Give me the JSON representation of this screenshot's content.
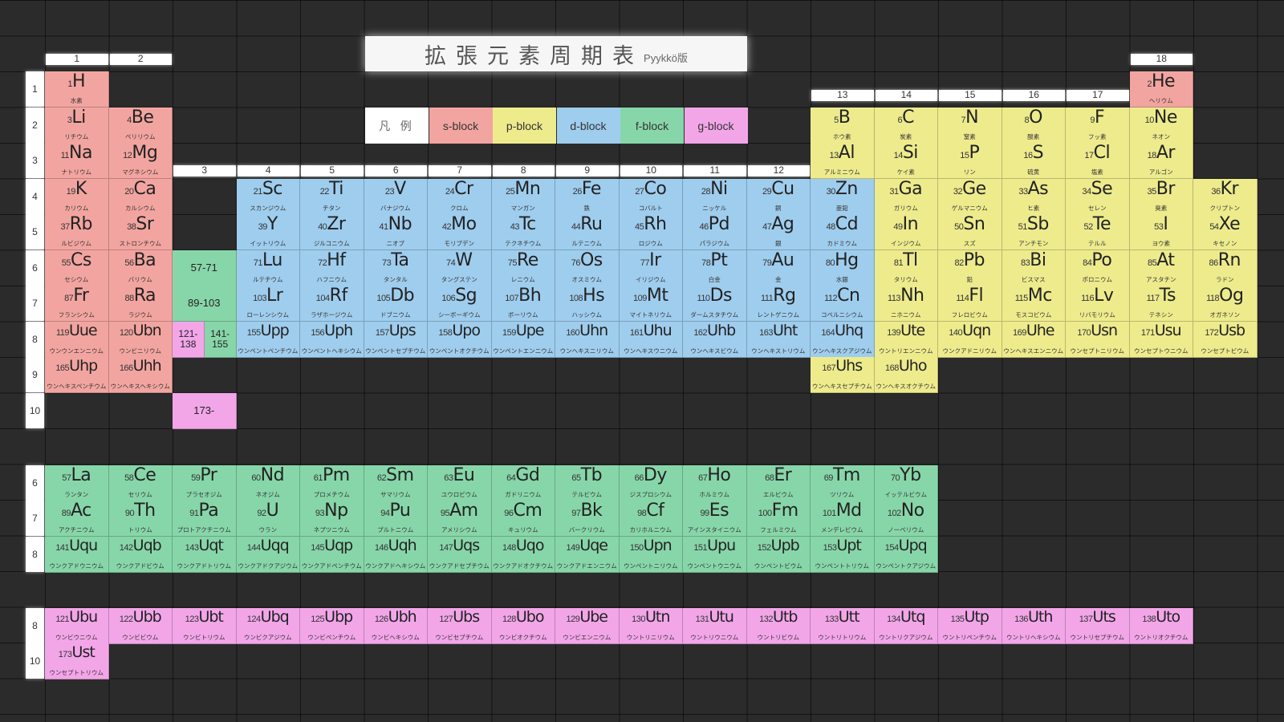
{
  "title": {
    "text": "拡張元素周期表",
    "subtitle": "Pyykkö版"
  },
  "legend": [
    {
      "label": "凡 例",
      "block": "none"
    },
    {
      "label": "s-block",
      "block": "s"
    },
    {
      "label": "p-block",
      "block": "p"
    },
    {
      "label": "d-block",
      "block": "d"
    },
    {
      "label": "f-block",
      "block": "f"
    },
    {
      "label": "g-block",
      "block": "g"
    }
  ],
  "block_colors": {
    "s": "#f2a5a0",
    "p": "#eeeb8d",
    "d": "#9fcdee",
    "f": "#87d6a9",
    "g": "#f2a6e8"
  },
  "group_headers": [
    "1",
    "2",
    "3",
    "4",
    "5",
    "6",
    "7",
    "8",
    "9",
    "10",
    "11",
    "12",
    "13",
    "14",
    "15",
    "16",
    "17",
    "18"
  ],
  "period_headers": [
    "1",
    "2",
    "3",
    "4",
    "5",
    "6",
    "7",
    "8",
    "9",
    "10"
  ],
  "sub_period_headers": [
    "6",
    "7",
    "8",
    "8",
    "10"
  ],
  "main_rows": [
    [
      [
        1,
        "H",
        "水素",
        "s"
      ],
      null,
      null,
      null,
      null,
      null,
      null,
      null,
      null,
      null,
      null,
      null,
      null,
      null,
      null,
      null,
      null,
      [
        2,
        "He",
        "ヘリウム",
        "s"
      ]
    ],
    [
      [
        3,
        "Li",
        "リチウム",
        "s"
      ],
      [
        4,
        "Be",
        "ベリリウム",
        "s"
      ],
      null,
      null,
      null,
      null,
      null,
      null,
      null,
      null,
      null,
      null,
      [
        5,
        "B",
        "ホウ素",
        "p"
      ],
      [
        6,
        "C",
        "炭素",
        "p"
      ],
      [
        7,
        "N",
        "窒素",
        "p"
      ],
      [
        8,
        "O",
        "酸素",
        "p"
      ],
      [
        9,
        "F",
        "フッ素",
        "p"
      ],
      [
        10,
        "Ne",
        "ネオン",
        "p"
      ]
    ],
    [
      [
        11,
        "Na",
        "ナトリウム",
        "s"
      ],
      [
        12,
        "Mg",
        "マグネシウム",
        "s"
      ],
      null,
      null,
      null,
      null,
      null,
      null,
      null,
      null,
      null,
      null,
      [
        13,
        "Al",
        "アルミニウム",
        "p"
      ],
      [
        14,
        "Si",
        "ケイ素",
        "p"
      ],
      [
        15,
        "P",
        "リン",
        "p"
      ],
      [
        16,
        "S",
        "硫黄",
        "p"
      ],
      [
        17,
        "Cl",
        "塩素",
        "p"
      ],
      [
        18,
        "Ar",
        "アルゴン",
        "p"
      ]
    ],
    [
      [
        19,
        "K",
        "カリウム",
        "s"
      ],
      [
        20,
        "Ca",
        "カルシウム",
        "s"
      ],
      null,
      [
        21,
        "Sc",
        "スカンジウム",
        "d"
      ],
      [
        22,
        "Ti",
        "チタン",
        "d"
      ],
      [
        23,
        "V",
        "バナジウム",
        "d"
      ],
      [
        24,
        "Cr",
        "クロム",
        "d"
      ],
      [
        25,
        "Mn",
        "マンガン",
        "d"
      ],
      [
        26,
        "Fe",
        "鉄",
        "d"
      ],
      [
        27,
        "Co",
        "コバルト",
        "d"
      ],
      [
        28,
        "Ni",
        "ニッケル",
        "d"
      ],
      [
        29,
        "Cu",
        "銅",
        "d"
      ],
      [
        30,
        "Zn",
        "亜鉛",
        "d"
      ],
      [
        31,
        "Ga",
        "ガリウム",
        "p"
      ],
      [
        32,
        "Ge",
        "ゲルマニウム",
        "p"
      ],
      [
        33,
        "As",
        "ヒ素",
        "p"
      ],
      [
        34,
        "Se",
        "セレン",
        "p"
      ],
      [
        35,
        "Br",
        "臭素",
        "p"
      ],
      [
        36,
        "Kr",
        "クリプトン",
        "p"
      ]
    ],
    [
      [
        37,
        "Rb",
        "ルビジウム",
        "s"
      ],
      [
        38,
        "Sr",
        "ストロンチウム",
        "s"
      ],
      null,
      [
        39,
        "Y",
        "イットリウム",
        "d"
      ],
      [
        40,
        "Zr",
        "ジルコニウム",
        "d"
      ],
      [
        41,
        "Nb",
        "ニオブ",
        "d"
      ],
      [
        42,
        "Mo",
        "モリブデン",
        "d"
      ],
      [
        43,
        "Tc",
        "テクネチウム",
        "d"
      ],
      [
        44,
        "Ru",
        "ルテニウム",
        "d"
      ],
      [
        45,
        "Rh",
        "ロジウム",
        "d"
      ],
      [
        46,
        "Pd",
        "パラジウム",
        "d"
      ],
      [
        47,
        "Ag",
        "銀",
        "d"
      ],
      [
        48,
        "Cd",
        "カドミウム",
        "d"
      ],
      [
        49,
        "In",
        "インジウム",
        "p"
      ],
      [
        50,
        "Sn",
        "スズ",
        "p"
      ],
      [
        51,
        "Sb",
        "アンチモン",
        "p"
      ],
      [
        52,
        "Te",
        "テルル",
        "p"
      ],
      [
        53,
        "I",
        "ヨウ素",
        "p"
      ],
      [
        54,
        "Xe",
        "キセノン",
        "p"
      ]
    ],
    [
      [
        55,
        "Cs",
        "セシウム",
        "s"
      ],
      [
        56,
        "Ba",
        "バリウム",
        "s"
      ],
      [
        "57-71",
        "f"
      ],
      [
        71,
        "Lu",
        "ルテチウム",
        "d"
      ],
      [
        72,
        "Hf",
        "ハフニウム",
        "d"
      ],
      [
        73,
        "Ta",
        "タンタル",
        "d"
      ],
      [
        74,
        "W",
        "タングステン",
        "d"
      ],
      [
        75,
        "Re",
        "レニウム",
        "d"
      ],
      [
        76,
        "Os",
        "オスミウム",
        "d"
      ],
      [
        77,
        "Ir",
        "イリジウム",
        "d"
      ],
      [
        78,
        "Pt",
        "白金",
        "d"
      ],
      [
        79,
        "Au",
        "金",
        "d"
      ],
      [
        80,
        "Hg",
        "水銀",
        "d"
      ],
      [
        81,
        "Tl",
        "タリウム",
        "p"
      ],
      [
        82,
        "Pb",
        "鉛",
        "p"
      ],
      [
        83,
        "Bi",
        "ビスマス",
        "p"
      ],
      [
        84,
        "Po",
        "ポロニウム",
        "p"
      ],
      [
        85,
        "At",
        "アスタチン",
        "p"
      ],
      [
        86,
        "Rn",
        "ラドン",
        "p"
      ]
    ],
    [
      [
        87,
        "Fr",
        "フランシウム",
        "s"
      ],
      [
        88,
        "Ra",
        "ラジウム",
        "s"
      ],
      [
        "89-103",
        "f"
      ],
      [
        103,
        "Lr",
        "ローレンシウム",
        "d"
      ],
      [
        104,
        "Rf",
        "ラザホージウム",
        "d"
      ],
      [
        105,
        "Db",
        "ドブニウム",
        "d"
      ],
      [
        106,
        "Sg",
        "シーボーギウム",
        "d"
      ],
      [
        107,
        "Bh",
        "ボーリウム",
        "d"
      ],
      [
        108,
        "Hs",
        "ハッシウム",
        "d"
      ],
      [
        109,
        "Mt",
        "マイトネリウム",
        "d"
      ],
      [
        110,
        "Ds",
        "ダームスタチウム",
        "d"
      ],
      [
        111,
        "Rg",
        "レントゲニウム",
        "d"
      ],
      [
        112,
        "Cn",
        "コペルニシウム",
        "d"
      ],
      [
        113,
        "Nh",
        "ニホニウム",
        "p"
      ],
      [
        114,
        "Fl",
        "フレロビウム",
        "p"
      ],
      [
        115,
        "Mc",
        "モスコビウム",
        "p"
      ],
      [
        116,
        "Lv",
        "リバモリウム",
        "p"
      ],
      [
        117,
        "Ts",
        "テネシン",
        "p"
      ],
      [
        118,
        "Og",
        "オガネソン",
        "p"
      ]
    ],
    [
      [
        119,
        "Uue",
        "ウンウンエンニウム",
        "s"
      ],
      [
        120,
        "Ubn",
        "ウンビニリウム",
        "s"
      ],
      "split",
      [
        155,
        "Upp",
        "ウンペントペンチウム",
        "d"
      ],
      [
        156,
        "Uph",
        "ウンペントヘキシウム",
        "d"
      ],
      [
        157,
        "Ups",
        "ウンペントセプチウム",
        "d"
      ],
      [
        158,
        "Upo",
        "ウンペントオクチウム",
        "d"
      ],
      [
        159,
        "Upe",
        "ウンペントエンニウム",
        "d"
      ],
      [
        160,
        "Uhn",
        "ウンヘキスニリウム",
        "d"
      ],
      [
        161,
        "Uhu",
        "ウンヘキスウニウム",
        "d"
      ],
      [
        162,
        "Uhb",
        "ウンヘキスビウム",
        "d"
      ],
      [
        163,
        "Uht",
        "ウンヘキストリウム",
        "d"
      ],
      [
        164,
        "Uhq",
        "ウンヘキスクアジウム",
        "d"
      ],
      [
        139,
        "Ute",
        "ウントリエンニウム",
        "p"
      ],
      [
        140,
        "Uqn",
        "ウンクアドニリウム",
        "p"
      ],
      [
        169,
        "Uhe",
        "ウンヘキスエンニウム",
        "p"
      ],
      [
        170,
        "Usn",
        "ウンセプトニリウム",
        "p"
      ],
      [
        171,
        "Usu",
        "ウンセプトウニウム",
        "p"
      ],
      [
        172,
        "Usb",
        "ウンセプトビウム",
        "p"
      ]
    ],
    [
      [
        165,
        "Uhp",
        "ウンヘキスペンチウム",
        "s"
      ],
      [
        166,
        "Uhh",
        "ウンヘキスヘキシウム",
        "s"
      ],
      null,
      null,
      null,
      null,
      null,
      null,
      null,
      null,
      null,
      null,
      [
        167,
        "Uhs",
        "ウンヘキスセプチウム",
        "p"
      ],
      [
        168,
        "Uho",
        "ウンヘキスオクチウム",
        "p"
      ],
      null,
      null,
      null,
      null
    ],
    [
      null,
      null,
      [
        "173-",
        "g"
      ],
      null,
      null,
      null,
      null,
      null,
      null,
      null,
      null,
      null,
      null,
      null,
      null,
      null,
      null,
      null
    ]
  ],
  "split_cells": [
    {
      "label": "121-\n138",
      "block": "g"
    },
    {
      "label": "141-\n155",
      "block": "f"
    }
  ],
  "f_series": [
    [
      [
        57,
        "La",
        "ランタン"
      ],
      [
        58,
        "Ce",
        "セリウム"
      ],
      [
        59,
        "Pr",
        "プラセオジム"
      ],
      [
        60,
        "Nd",
        "ネオジム"
      ],
      [
        61,
        "Pm",
        "プロメチウム"
      ],
      [
        62,
        "Sm",
        "サマリウム"
      ],
      [
        63,
        "Eu",
        "ユウロピウム"
      ],
      [
        64,
        "Gd",
        "ガドリニウム"
      ],
      [
        65,
        "Tb",
        "テルビウム"
      ],
      [
        66,
        "Dy",
        "ジスプロシウム"
      ],
      [
        67,
        "Ho",
        "ホルミウム"
      ],
      [
        68,
        "Er",
        "エルビウム"
      ],
      [
        69,
        "Tm",
        "ツリウム"
      ],
      [
        70,
        "Yb",
        "イッテルビウム"
      ]
    ],
    [
      [
        89,
        "Ac",
        "アクチニウム"
      ],
      [
        90,
        "Th",
        "トリウム"
      ],
      [
        91,
        "Pa",
        "プロトアクチニウム"
      ],
      [
        92,
        "U",
        "ウラン"
      ],
      [
        93,
        "Np",
        "ネプツニウム"
      ],
      [
        94,
        "Pu",
        "プルトニウム"
      ],
      [
        95,
        "Am",
        "アメリシウム"
      ],
      [
        96,
        "Cm",
        "キュリウム"
      ],
      [
        97,
        "Bk",
        "バークリウム"
      ],
      [
        98,
        "Cf",
        "カリホルニウム"
      ],
      [
        99,
        "Es",
        "アインスタイニウム"
      ],
      [
        100,
        "Fm",
        "フェルミウム"
      ],
      [
        101,
        "Md",
        "メンデレビウム"
      ],
      [
        102,
        "No",
        "ノーベリウム"
      ]
    ],
    [
      [
        141,
        "Uqu",
        "ウンクアドウニウム"
      ],
      [
        142,
        "Uqb",
        "ウンクアドビウム"
      ],
      [
        143,
        "Uqt",
        "ウンクアドトリウム"
      ],
      [
        144,
        "Uqq",
        "ウンクアドクアジウム"
      ],
      [
        145,
        "Uqp",
        "ウンクアドペンチウム"
      ],
      [
        146,
        "Uqh",
        "ウンクアドヘキシウム"
      ],
      [
        147,
        "Uqs",
        "ウンクアドセプチウム"
      ],
      [
        148,
        "Uqo",
        "ウンクアドオクチウム"
      ],
      [
        149,
        "Uqe",
        "ウンクアドエンニウム"
      ],
      [
        150,
        "Upn",
        "ウンペントニリウム"
      ],
      [
        151,
        "Upu",
        "ウンペントウニウム"
      ],
      [
        152,
        "Upb",
        "ウンペントビウム"
      ],
      [
        153,
        "Upt",
        "ウンペントトリウム"
      ],
      [
        154,
        "Upq",
        "ウンペントクアジウム"
      ]
    ]
  ],
  "g_series": [
    [
      [
        121,
        "Ubu",
        "ウンビウニウム"
      ],
      [
        122,
        "Ubb",
        "ウンビビウム"
      ],
      [
        123,
        "Ubt",
        "ウンビトリウム"
      ],
      [
        124,
        "Ubq",
        "ウンビクアジウム"
      ],
      [
        125,
        "Ubp",
        "ウンビペンチウム"
      ],
      [
        126,
        "Ubh",
        "ウンビヘキシウム"
      ],
      [
        127,
        "Ubs",
        "ウンビセプチウム"
      ],
      [
        128,
        "Ubo",
        "ウンビオクチウム"
      ],
      [
        129,
        "Ube",
        "ウンビエンニウム"
      ],
      [
        130,
        "Utn",
        "ウントリニリウム"
      ],
      [
        131,
        "Utu",
        "ウントリウニウム"
      ],
      [
        132,
        "Utb",
        "ウントリビウム"
      ],
      [
        133,
        "Utt",
        "ウントリトリウム"
      ],
      [
        134,
        "Utq",
        "ウントリクアジウム"
      ],
      [
        135,
        "Utp",
        "ウントリペンチウム"
      ],
      [
        136,
        "Uth",
        "ウントリヘキシウム"
      ],
      [
        137,
        "Uts",
        "ウントリセプチウム"
      ],
      [
        138,
        "Uto",
        "ウントリオクチウム"
      ]
    ],
    [
      [
        173,
        "Ust",
        "ウンセプトトリウム"
      ]
    ]
  ]
}
